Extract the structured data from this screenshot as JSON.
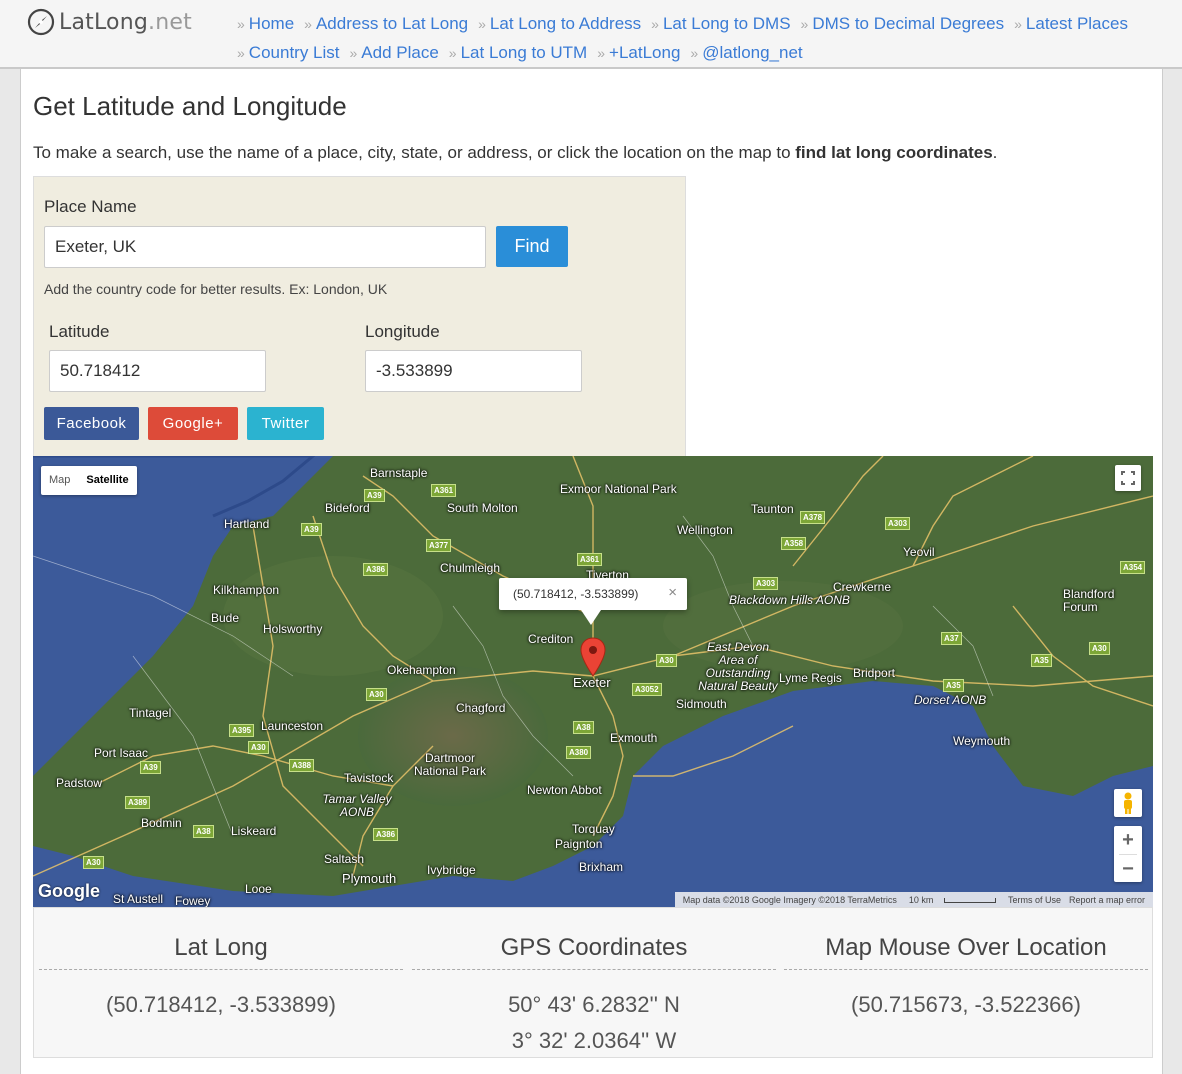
{
  "site": {
    "logo_name": "LatLong",
    "logo_tld": ".net"
  },
  "nav": {
    "row1": [
      "Home",
      "Address to Lat Long",
      "Lat Long to Address",
      "Lat Long to DMS",
      "DMS to Decimal Degrees",
      "Latest Places"
    ],
    "row2": [
      "Country List",
      "Add Place",
      "Lat Long to UTM",
      "+LatLong",
      "@latlong_net"
    ]
  },
  "page": {
    "title": "Get Latitude and Longitude",
    "intro_prefix": "To make a search, use the name of a place, city, state, or address, or click the location on the map to ",
    "intro_bold": "find lat long coordinates",
    "intro_suffix": "."
  },
  "search": {
    "place_label": "Place Name",
    "place_value": "Exeter, UK",
    "find_label": "Find",
    "hint": "Add the country code for better results. Ex: London, UK",
    "lat_label": "Latitude",
    "lat_value": "50.718412",
    "lng_label": "Longitude",
    "lng_value": "-3.533899"
  },
  "share": {
    "facebook": "Facebook",
    "googleplus": "Google+",
    "twitter": "Twitter"
  },
  "map": {
    "type_map": "Map",
    "type_satellite": "Satellite",
    "info": "(50.718412, -3.533899)",
    "info_close": "×",
    "google": "Google",
    "attribution": "Map data ©2018 Google Imagery ©2018 TerraMetrics",
    "scale": "10 km",
    "terms": "Terms of Use",
    "report": "Report a map error",
    "zoom_in": "+",
    "zoom_out": "−",
    "places": [
      "Barnstaple",
      "Exmoor National Park",
      "Bideford",
      "South Molton",
      "Taunton",
      "Hartland",
      "Wellington",
      "Yeovil",
      "Chulmleigh",
      "Tiverton",
      "Kilkhampton",
      "Crewkerne",
      "Blackdown Hills AONB",
      "Bude",
      "Holsworthy",
      "Crediton",
      "East Devon Area of Outstanding Natural Beauty",
      "Blandford Forum",
      "Okehampton",
      "Exeter",
      "Lyme Regis",
      "Bridport",
      "Sidmouth",
      "Dorset AONB",
      "Chagford",
      "Tintagel",
      "Launceston",
      "Exmouth",
      "Weymouth",
      "Port Isaac",
      "Dartmoor National Park",
      "Tavistock",
      "Padstow",
      "Newton Abbot",
      "Tamar Valley AONB",
      "Bodmin",
      "Liskeard",
      "Torquay",
      "Paignton",
      "Saltash",
      "Brixham",
      "Ivybridge",
      "Plymouth",
      "Looe",
      "St Austell",
      "Fowey"
    ],
    "roads": [
      "A39",
      "A361",
      "A377",
      "A386",
      "A303",
      "A378",
      "A358",
      "A354",
      "A30",
      "A3052",
      "A35",
      "A37",
      "A395",
      "A388",
      "A389",
      "A38",
      "A380"
    ]
  },
  "results": {
    "latlong_head": "Lat Long",
    "latlong_val": "(50.718412, -3.533899)",
    "gps_head": "GPS Coordinates",
    "gps_lat": "50° 43' 6.2832'' N",
    "gps_lng": "3° 32' 2.0364'' W",
    "mouse_head": "Map Mouse Over Location",
    "mouse_val": "(50.715673, -3.522366)"
  },
  "colors": {
    "link": "#3a7bd5",
    "find": "#2a8ed8",
    "facebook": "#3b5998",
    "googleplus": "#dd4b39",
    "twitter": "#2bb3d0",
    "search_bg": "#f0ede0"
  }
}
